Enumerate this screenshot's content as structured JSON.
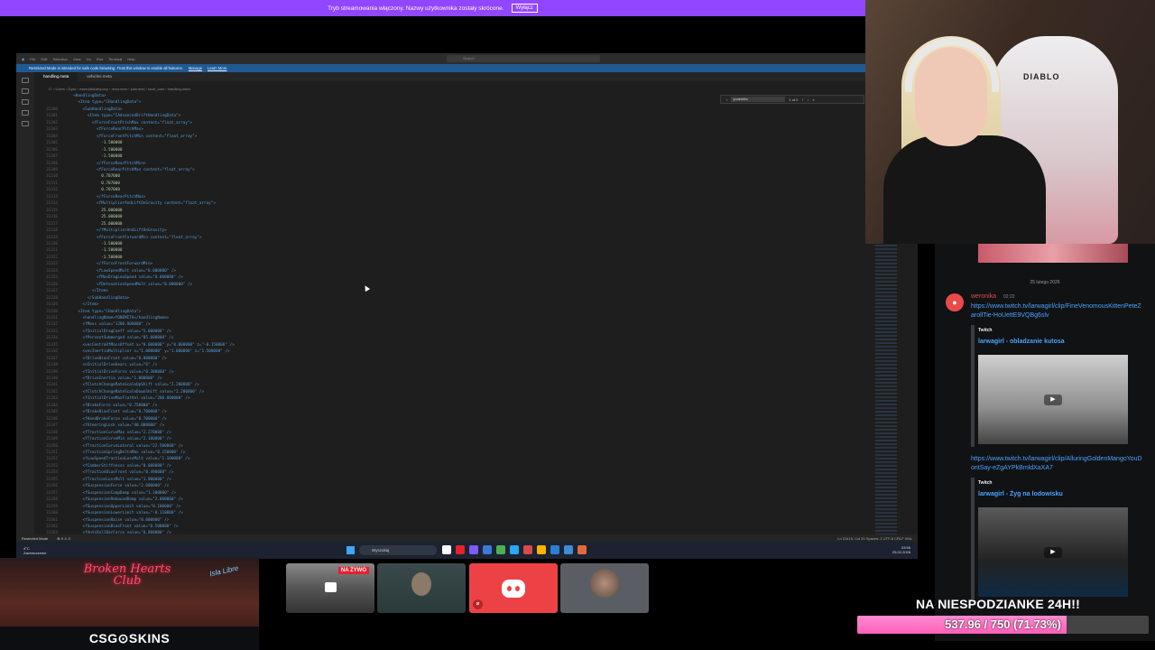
{
  "banner": {
    "text": "Tryb streamowania włączony. Nazwy użytkownika zostały skrócone.",
    "button": "Wyłącz"
  },
  "vscode": {
    "menu": [
      "File",
      "Edit",
      "Selection",
      "View",
      "Go",
      "Run",
      "Terminal",
      "Help"
    ],
    "search_placeholder": "Search",
    "restricted_text": "Restricted Mode is intended for safe code browsing. Trust this window to enable all features.",
    "restricted_manage": "Manage",
    "restricted_learn": "Learn More",
    "tabs": [
      "handling.meta",
      "vehicles.meta"
    ],
    "breadcrumb": "C: › Users › Dysk › essentialsdmpony › resources › pobrane] › local_cars › handling.meta",
    "find_query": "yonemita",
    "find_count": "1 of 2",
    "code_lines": [
      {
        "n": "",
        "indent": 2,
        "tag": "<HandlingData>",
        "val": ""
      },
      {
        "n": "",
        "indent": 4,
        "tag": "<Item type=\"CHandlingData\">",
        "val": ""
      },
      {
        "n": "31300",
        "indent": 6,
        "tag": "<SubHandlingData>",
        "val": ""
      },
      {
        "n": "31301",
        "indent": 8,
        "tag": "<Item type=\"CAdvancedDriftHandlingData\">",
        "val": ""
      },
      {
        "n": "31302",
        "indent": 10,
        "tag": "<fForceFrontPitchMax content=\"float_array\">",
        "val": ""
      },
      {
        "n": "31303",
        "indent": 12,
        "tag": "<fForceRearPitchMax>",
        "val": ""
      },
      {
        "n": "31304",
        "indent": 12,
        "tag": "<fForceFrontPitchMin content=\"float_array\">",
        "val": ""
      },
      {
        "n": "31305",
        "indent": 14,
        "tag": "",
        "val": "-1.500000"
      },
      {
        "n": "31306",
        "indent": 14,
        "tag": "",
        "val": "-1.500000"
      },
      {
        "n": "31307",
        "indent": 14,
        "tag": "",
        "val": "-1.500000"
      },
      {
        "n": "31308",
        "indent": 12,
        "tag": "</fForceRearPitchMin>",
        "val": ""
      },
      {
        "n": "31309",
        "indent": 12,
        "tag": "<fForceRearPitchMax content=\"float_array\">",
        "val": ""
      },
      {
        "n": "31310",
        "indent": 14,
        "tag": "",
        "val": "0.707000"
      },
      {
        "n": "31311",
        "indent": 14,
        "tag": "",
        "val": "0.707000"
      },
      {
        "n": "31312",
        "indent": 14,
        "tag": "",
        "val": "0.707000"
      },
      {
        "n": "31313",
        "indent": 12,
        "tag": "</fForceRearPitchMax>",
        "val": ""
      },
      {
        "n": "31314",
        "indent": 12,
        "tag": "<fMultiplierAndLiftOnGravity content=\"float_array\">",
        "val": ""
      },
      {
        "n": "31315",
        "indent": 14,
        "tag": "",
        "val": "25.000000"
      },
      {
        "n": "31316",
        "indent": 14,
        "tag": "",
        "val": "25.000000"
      },
      {
        "n": "31317",
        "indent": 14,
        "tag": "",
        "val": "25.000000"
      },
      {
        "n": "31318",
        "indent": 12,
        "tag": "</fMultiplierAndLiftOnGravity>",
        "val": ""
      },
      {
        "n": "31319",
        "indent": 12,
        "tag": "<fForceFrontForwardMin content=\"float_array\">",
        "val": ""
      },
      {
        "n": "31320",
        "indent": 14,
        "tag": "",
        "val": "-1.500000"
      },
      {
        "n": "31321",
        "indent": 14,
        "tag": "",
        "val": "-1.500000"
      },
      {
        "n": "31322",
        "indent": 14,
        "tag": "",
        "val": "-1.500000"
      },
      {
        "n": "31323",
        "indent": 12,
        "tag": "</fForceFrontForwardMin>",
        "val": ""
      },
      {
        "n": "31324",
        "indent": 12,
        "tag": "<fLowSpeedMult value=\"0.000000\" />",
        "val": ""
      },
      {
        "n": "31325",
        "indent": 12,
        "tag": "<fMaxDragLowSpeed value=\"0.000000\" />",
        "val": ""
      },
      {
        "n": "31326",
        "indent": 12,
        "tag": "<fDetonationSpeedMult value=\"0.000000\" />",
        "val": ""
      },
      {
        "n": "31327",
        "indent": 10,
        "tag": "</Item>",
        "val": ""
      },
      {
        "n": "31328",
        "indent": 8,
        "tag": "</SubHandlingData>",
        "val": ""
      },
      {
        "n": "31329",
        "indent": 6,
        "tag": "</Item>",
        "val": ""
      },
      {
        "n": "31330",
        "indent": 4,
        "tag": "<Item type=\"CHandlingData\">",
        "val": ""
      },
      {
        "n": "31331",
        "indent": 6,
        "tag": "<handlingName>YONEMITA</handlingName>",
        "val": ""
      },
      {
        "n": "31332",
        "indent": 6,
        "tag": "<fMass value=\"1200.000000\" />",
        "val": ""
      },
      {
        "n": "31333",
        "indent": 6,
        "tag": "<fInitialDragCoeff value=\"5.000000\" />",
        "val": ""
      },
      {
        "n": "31334",
        "indent": 6,
        "tag": "<fPercentSubmerged value=\"85.000000\" />",
        "val": ""
      },
      {
        "n": "31335",
        "indent": 6,
        "tag": "<vecCentreOfMassOffset x=\"0.000000\" y=\"0.000000\" z=\"-0.150000\" />",
        "val": ""
      },
      {
        "n": "31336",
        "indent": 6,
        "tag": "<vecInertiaMultiplier x=\"1.000000\" y=\"1.000000\" z=\"1.500000\" />",
        "val": ""
      },
      {
        "n": "31337",
        "indent": 6,
        "tag": "<fDriveBiasFront value=\"0.000000\" />",
        "val": ""
      },
      {
        "n": "31338",
        "indent": 6,
        "tag": "<nInitialDriveGears value=\"6\" />",
        "val": ""
      },
      {
        "n": "31339",
        "indent": 6,
        "tag": "<fInitialDriveForce value=\"0.380000\" />",
        "val": ""
      },
      {
        "n": "31340",
        "indent": 6,
        "tag": "<fDriveInertia value=\"1.000000\" />",
        "val": ""
      },
      {
        "n": "31341",
        "indent": 6,
        "tag": "<fClutchChangeRateScaleUpShift value=\"2.200000\" />",
        "val": ""
      },
      {
        "n": "31342",
        "indent": 6,
        "tag": "<fClutchChangeRateScaleDownShift value=\"2.200000\" />",
        "val": ""
      },
      {
        "n": "31343",
        "indent": 6,
        "tag": "<fInitialDriveMaxFlatVel value=\"200.000000\" />",
        "val": ""
      },
      {
        "n": "31344",
        "indent": 6,
        "tag": "<fBrakeForce value=\"0.750000\" />",
        "val": ""
      },
      {
        "n": "31345",
        "indent": 6,
        "tag": "<fBrakeBiasFront value=\"0.700000\" />",
        "val": ""
      },
      {
        "n": "31346",
        "indent": 6,
        "tag": "<fHandBrakeForce value=\"0.700000\" />",
        "val": ""
      },
      {
        "n": "31347",
        "indent": 6,
        "tag": "<fSteeringLock value=\"40.000000\" />",
        "val": ""
      },
      {
        "n": "31348",
        "indent": 6,
        "tag": "<fTractionCurveMax value=\"2.270000\" />",
        "val": ""
      },
      {
        "n": "31349",
        "indent": 6,
        "tag": "<fTractionCurveMin value=\"2.100000\" />",
        "val": ""
      },
      {
        "n": "31350",
        "indent": 6,
        "tag": "<fTractionCurveLateral value=\"22.500000\" />",
        "val": ""
      },
      {
        "n": "31351",
        "indent": 6,
        "tag": "<fTractionSpringDeltaMax value=\"0.150000\" />",
        "val": ""
      },
      {
        "n": "31352",
        "indent": 6,
        "tag": "<fLowSpeedTractionLossMult value=\"1.100000\" />",
        "val": ""
      },
      {
        "n": "31353",
        "indent": 6,
        "tag": "<fCamberStiffnesss value=\"0.000000\" />",
        "val": ""
      },
      {
        "n": "31354",
        "indent": 6,
        "tag": "<fTractionBiasFront value=\"0.490000\" />",
        "val": ""
      },
      {
        "n": "31355",
        "indent": 6,
        "tag": "<fTractionLossMult value=\"1.000000\" />",
        "val": ""
      },
      {
        "n": "31356",
        "indent": 6,
        "tag": "<fSuspensionForce value=\"2.600000\" />",
        "val": ""
      },
      {
        "n": "31357",
        "indent": 6,
        "tag": "<fSuspensionCompDamp value=\"1.300000\" />",
        "val": ""
      },
      {
        "n": "31358",
        "indent": 6,
        "tag": "<fSuspensionReboundDamp value=\"2.000000\" />",
        "val": ""
      },
      {
        "n": "31359",
        "indent": 6,
        "tag": "<fSuspensionUpperLimit value=\"0.100000\" />",
        "val": ""
      },
      {
        "n": "31360",
        "indent": 6,
        "tag": "<fSuspensionLowerLimit value=\"-0.110000\" />",
        "val": ""
      },
      {
        "n": "31361",
        "indent": 6,
        "tag": "<fSuspensionRaise value=\"0.000000\" />",
        "val": ""
      },
      {
        "n": "31362",
        "indent": 6,
        "tag": "<fSuspensionBiasFront value=\"0.500000\" />",
        "val": ""
      },
      {
        "n": "31363",
        "indent": 6,
        "tag": "<fAntiRollBarForce value=\"0.800000\" />",
        "val": ""
      }
    ],
    "status_left": "Restricted Mode",
    "status_errors": "⊗ 0 ⚠ 0",
    "status_right": "Ln 31415, Col 20   Spaces: 2   UTF-8   CRLF   XML",
    "weather_temp": "4°C",
    "weather_desc": "Zachmurzenie",
    "taskbar_search": "Wyszukaj",
    "clock_time": "03:56",
    "clock_date": "25.02.2026",
    "app_colors": [
      "#ffffff",
      "#e8202c",
      "#7b5cff",
      "#3a7bd5",
      "#4caf50",
      "#2aa7ff",
      "#d94a4a",
      "#ffb300",
      "#2a7fd4",
      "#3f8cd4",
      "#e06a3a"
    ]
  },
  "chat": {
    "date": "25 lutego 2026",
    "user": "weronika",
    "time": "02:22",
    "message1": "https://www.twitch.tv/larwagirl/clip/FineVenomousKittenPeteZarollTie-HoUettE9VQBg6slv",
    "source1": "Twitch",
    "title1": "larwagirl - obladzanie kutosa",
    "message2": "https://www.twitch.tv/larwagirl/clip/AlluringGoldenMangoYouDontSay-eZgAYPkBmldXaXA7",
    "source2": "Twitch",
    "title2": "larwagirl - Żyg na lodowisku"
  },
  "tiles": {
    "live_badge": "NA ŻYWO"
  },
  "game": {
    "sign": "Broken Hearts Club",
    "side": "Isla Libre",
    "sponsor": "CSG⊙SKINS"
  },
  "goal": {
    "title": "NA NIESPODZIANKE 24H!!",
    "current": 537.96,
    "target": 750,
    "progress_fraction": 0.7173,
    "label": "537.96 / 750 (71.73%)"
  },
  "webcam": {
    "chair_logo": "DIABLO"
  }
}
